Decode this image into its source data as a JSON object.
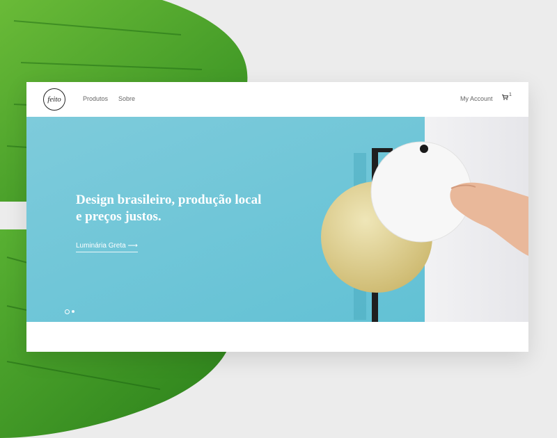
{
  "brand": {
    "logo_text": "feito"
  },
  "nav": {
    "items": [
      {
        "label": "Produtos"
      },
      {
        "label": "Sobre"
      }
    ],
    "account_label": "My Account",
    "cart_count": "1"
  },
  "hero": {
    "headline_line1": "Design brasileiro, produção local",
    "headline_line2": "e preços justos.",
    "link_label": "Luminária Greta ⟶",
    "slides_total": 2,
    "active_slide": 1
  },
  "colors": {
    "hero_blue": "#65c3d6",
    "lamp_gold": "#d9c98a",
    "leaf_green": "#3f9a2a"
  }
}
